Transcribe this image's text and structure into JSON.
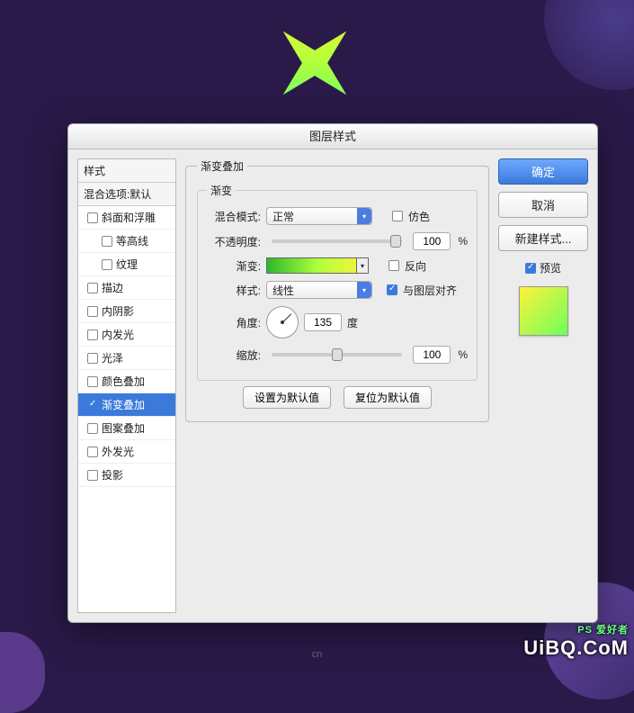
{
  "header": {
    "title": "图层样式"
  },
  "style_panel": {
    "header": "样式",
    "subheader": "混合选项:默认",
    "items": [
      {
        "label": "斜面和浮雕",
        "checked": false,
        "indent": false
      },
      {
        "label": "等高线",
        "checked": false,
        "indent": true
      },
      {
        "label": "纹理",
        "checked": false,
        "indent": true
      },
      {
        "label": "描边",
        "checked": false,
        "indent": false
      },
      {
        "label": "内阴影",
        "checked": false,
        "indent": false
      },
      {
        "label": "内发光",
        "checked": false,
        "indent": false
      },
      {
        "label": "光泽",
        "checked": false,
        "indent": false
      },
      {
        "label": "颜色叠加",
        "checked": false,
        "indent": false
      },
      {
        "label": "渐变叠加",
        "checked": true,
        "indent": false,
        "selected": true
      },
      {
        "label": "图案叠加",
        "checked": false,
        "indent": false
      },
      {
        "label": "外发光",
        "checked": false,
        "indent": false
      },
      {
        "label": "投影",
        "checked": false,
        "indent": false
      }
    ]
  },
  "center": {
    "group_title": "渐变叠加",
    "inner_title": "渐变",
    "blend_mode_label": "混合模式:",
    "blend_mode_value": "正常",
    "dither_label": "仿色",
    "opacity_label": "不透明度:",
    "opacity_value": "100",
    "percent_sign": "%",
    "gradient_label": "渐变:",
    "reverse_label": "反向",
    "style_label": "样式:",
    "style_value": "线性",
    "align_label": "与图层对齐",
    "align_checked": true,
    "angle_label": "角度:",
    "angle_value": "135",
    "angle_unit": "度",
    "scale_label": "缩放:",
    "scale_value": "100",
    "default_set": "设置为默认值",
    "default_reset": "复位为默认值"
  },
  "right": {
    "ok": "确定",
    "cancel": "取消",
    "new_style": "新建样式...",
    "preview_label": "预览",
    "preview_checked": true
  },
  "watermark": {
    "main": "UiBQ.CoM",
    "sub": "PS 爱好者"
  },
  "footer": "cn"
}
